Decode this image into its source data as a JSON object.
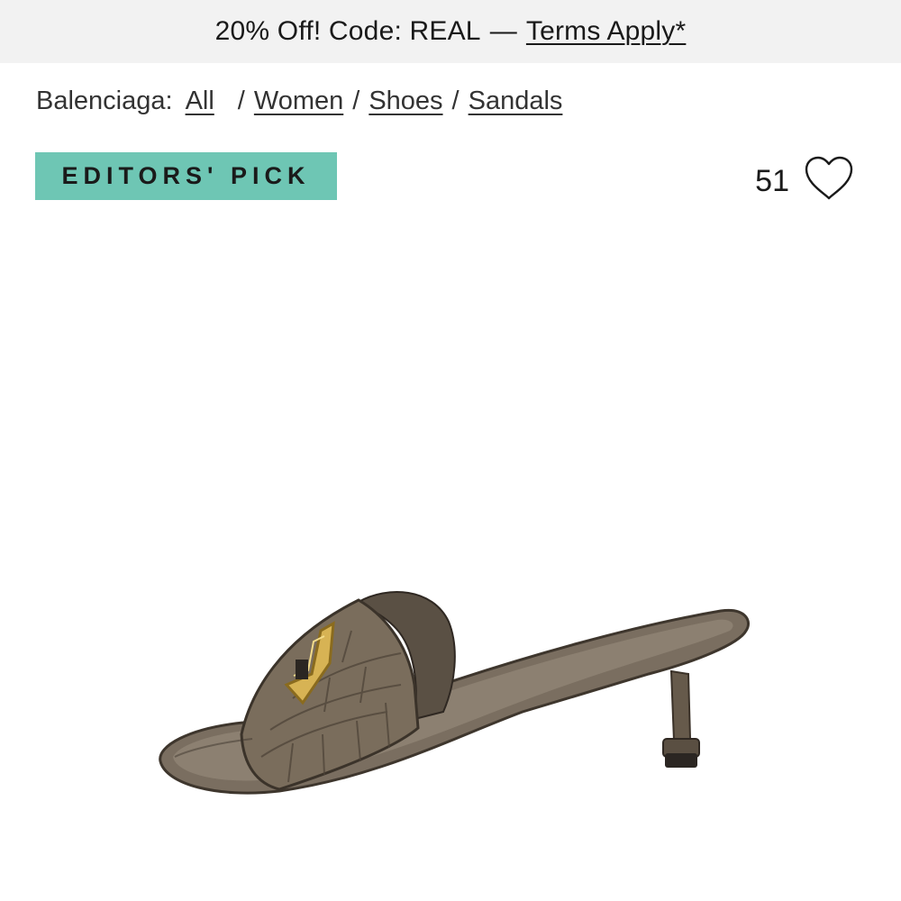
{
  "promo": {
    "text": "20% Off! Code: REAL",
    "separator": "—",
    "terms_link": "Terms Apply*"
  },
  "breadcrumb": {
    "brand": "Balenciaga:",
    "items": [
      {
        "label": "All"
      },
      {
        "label": "Women"
      },
      {
        "label": "Shoes"
      },
      {
        "label": "Sandals"
      }
    ],
    "separator": "/"
  },
  "badge": {
    "label": "EDITORS' PICK",
    "color": "#6ec6b4"
  },
  "favorites": {
    "count": "51",
    "icon": "heart-outline-icon"
  },
  "product": {
    "image": "sandal-image",
    "colors": {
      "leather": "#6e6354",
      "hardware": "#c9a646"
    }
  }
}
